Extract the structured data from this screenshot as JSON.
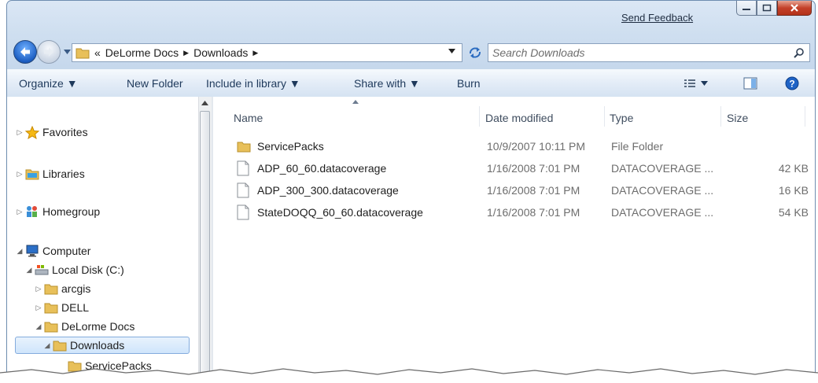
{
  "titlebar": {
    "send_feedback": "Send Feedback"
  },
  "address_bar": {
    "overflow": "«",
    "path": [
      "DeLorme Docs",
      "Downloads"
    ]
  },
  "search": {
    "placeholder": "Search Downloads"
  },
  "toolbar": {
    "organize": "Organize ▼",
    "new_folder": "New Folder",
    "include_in_library": "Include in library ▼",
    "share_with": "Share with ▼",
    "burn": "Burn"
  },
  "nav_pane": {
    "favorites": "Favorites",
    "libraries": "Libraries",
    "homegroup": "Homegroup",
    "computer": "Computer",
    "local_disk": "Local Disk (C:)",
    "arcgis": "arcgis",
    "dell": "DELL",
    "delorme_docs": "DeLorme Docs",
    "downloads": "Downloads",
    "servicepacks": "ServicePacks"
  },
  "columns": {
    "name": "Name",
    "date_modified": "Date modified",
    "type": "Type",
    "size": "Size"
  },
  "files": [
    {
      "name": "ServicePacks",
      "date": "10/9/2007 10:11 PM",
      "type": "File Folder",
      "size": "",
      "icon": "folder-icon"
    },
    {
      "name": "ADP_60_60.datacoverage",
      "date": "1/16/2008 7:01 PM",
      "type": "DATACOVERAGE ...",
      "size": "42 KB",
      "icon": "file-icon"
    },
    {
      "name": "ADP_300_300.datacoverage",
      "date": "1/16/2008 7:01 PM",
      "type": "DATACOVERAGE ...",
      "size": "16 KB",
      "icon": "file-icon"
    },
    {
      "name": "StateDOQQ_60_60.datacoverage",
      "date": "1/16/2008 7:01 PM",
      "type": "DATACOVERAGE ...",
      "size": "54 KB",
      "icon": "file-icon"
    }
  ],
  "colors": {
    "accent": "#1d5fc3",
    "selection": "#cfe5fb",
    "frame": "#c5d7ec",
    "close": "#c4412a"
  }
}
